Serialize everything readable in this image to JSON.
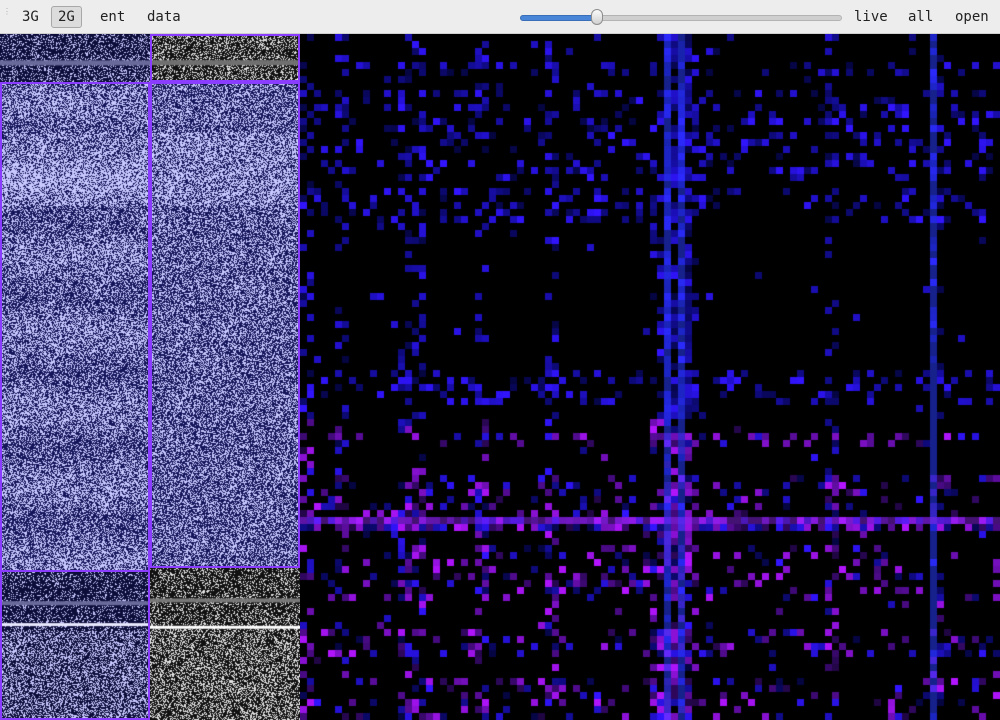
{
  "toolbar": {
    "buttons": [
      {
        "id": "3g",
        "label": "3G",
        "pressed": false
      },
      {
        "id": "2g",
        "label": "2G",
        "pressed": true
      },
      {
        "id": "ent",
        "label": "ent",
        "pressed": false
      },
      {
        "id": "data",
        "label": "data",
        "pressed": false
      }
    ],
    "zoom_slider": {
      "value": 0.24
    },
    "right_buttons": [
      {
        "id": "live",
        "label": "live"
      },
      {
        "id": "all",
        "label": "all"
      },
      {
        "id": "open",
        "label": "open"
      }
    ]
  },
  "colors": {
    "toolbar_bg": "#ededed",
    "selection": "#8a3cff",
    "accent": "#4a86d8",
    "matrix_blue": "#1a1aff",
    "matrix_violet": "#8a1aff",
    "binary_blue_fg": "#c8c8ff",
    "binary_blue_bg": "#14145a",
    "binary_gray_fg": "#e0e0e0"
  },
  "views": {
    "left_column": "binary-3g-overview",
    "middle_column": "binary-2g-overview",
    "right_panel": "byte-pair-matrix"
  }
}
